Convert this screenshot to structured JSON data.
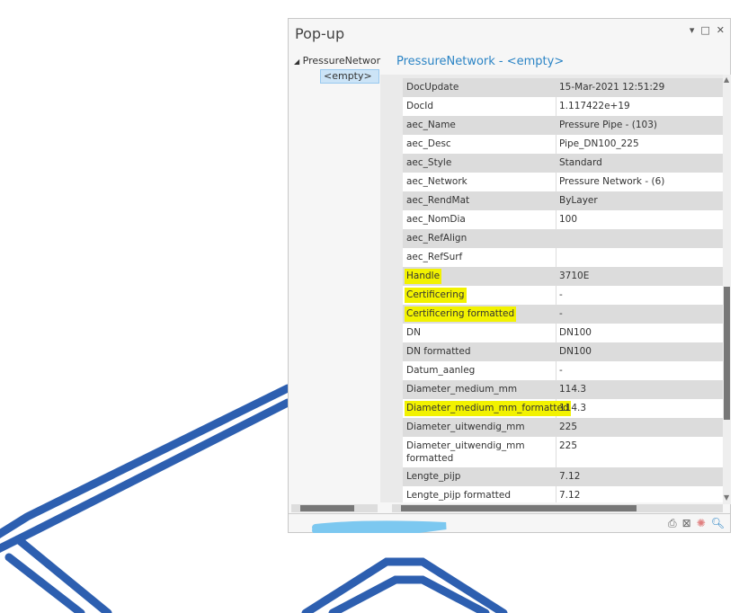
{
  "window": {
    "title": "Pop-up",
    "controls": [
      "▾",
      "□",
      "✕"
    ]
  },
  "tree": {
    "root": "PressureNetwor",
    "child": "<empty>"
  },
  "header": "PressureNetwork - <empty>",
  "rows": [
    {
      "field": "DocUpdate",
      "value": "15-Mar-2021 12:51:29",
      "highlight": false
    },
    {
      "field": "DocId",
      "value": "1.117422e+19",
      "highlight": false
    },
    {
      "field": "aec_Name",
      "value": "Pressure Pipe - (103)",
      "highlight": false
    },
    {
      "field": "aec_Desc",
      "value": "Pipe_DN100_225",
      "highlight": false
    },
    {
      "field": "aec_Style",
      "value": "Standard",
      "highlight": false
    },
    {
      "field": "aec_Network",
      "value": "Pressure Network - (6)",
      "highlight": false
    },
    {
      "field": "aec_RendMat",
      "value": "ByLayer",
      "highlight": false
    },
    {
      "field": "aec_NomDia",
      "value": "100",
      "highlight": false
    },
    {
      "field": "aec_RefAlign",
      "value": "",
      "highlight": false
    },
    {
      "field": "aec_RefSurf",
      "value": "",
      "highlight": false
    },
    {
      "field": "Handle",
      "value": "3710E",
      "highlight": true
    },
    {
      "field": "Certificering",
      "value": "-",
      "highlight": true
    },
    {
      "field": "Certificering formatted",
      "value": "-",
      "highlight": true
    },
    {
      "field": "DN",
      "value": "DN100",
      "highlight": false
    },
    {
      "field": "DN formatted",
      "value": "DN100",
      "highlight": false
    },
    {
      "field": "Datum_aanleg",
      "value": "-",
      "highlight": false
    },
    {
      "field": "Diameter_medium_mm",
      "value": "114.3",
      "highlight": false
    },
    {
      "field": "Diameter_medium_mm_formatted",
      "value": "114.3",
      "highlight": true
    },
    {
      "field": "Diameter_uitwendig_mm",
      "value": "225",
      "highlight": false
    },
    {
      "field": "Diameter_uitwendig_mm formatted",
      "value": "225",
      "highlight": false,
      "tall": true
    },
    {
      "field": "Lengte_pijp",
      "value": "7.12",
      "highlight": false
    },
    {
      "field": "Lengte_pijp formatted",
      "value": "7.12",
      "highlight": false
    }
  ],
  "colors": {
    "highlight": "#f2f200",
    "pipe": "#2d5fb0",
    "header": "#2b84c5",
    "scribble": "#7cc8f0"
  },
  "footer_icons": [
    "print-icon",
    "filter-icon",
    "flash-icon",
    "zoom-to-icon"
  ]
}
